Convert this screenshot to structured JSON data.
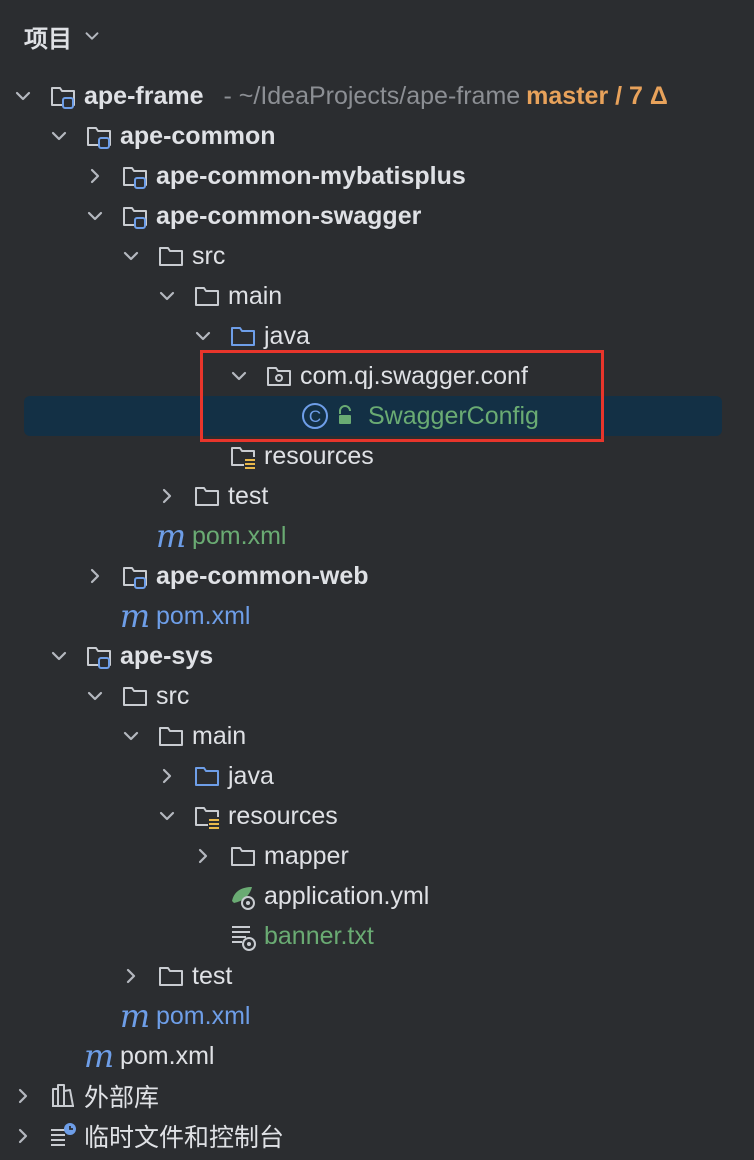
{
  "panel": {
    "title": "项目"
  },
  "tree": {
    "root": {
      "name": "ape-frame",
      "path": "- ~/IdeaProjects/ape-frame",
      "branch": "master / 7 Δ"
    },
    "ape_common": "ape-common",
    "ape_common_mybatisplus": "ape-common-mybatisplus",
    "ape_common_swagger": "ape-common-swagger",
    "swagger_src": "src",
    "swagger_main": "main",
    "swagger_java": "java",
    "swagger_pkg": "com.qj.swagger.conf",
    "swagger_class": "SwaggerConfig",
    "swagger_resources": "resources",
    "swagger_test": "test",
    "swagger_pom": "pom.xml",
    "ape_common_web": "ape-common-web",
    "common_pom": "pom.xml",
    "ape_sys": "ape-sys",
    "sys_src": "src",
    "sys_main": "main",
    "sys_java": "java",
    "sys_resources": "resources",
    "sys_mapper": "mapper",
    "sys_app_yml": "application.yml",
    "sys_banner": "banner.txt",
    "sys_test": "test",
    "sys_pom": "pom.xml",
    "root_pom": "pom.xml",
    "external_libs": "外部库",
    "scratches": "临时文件和控制台"
  },
  "icons": {
    "class_letter": "C",
    "maven_letter": "m"
  },
  "colors": {
    "background": "#2b2d30",
    "selection": "#133045",
    "highlight_box": "#e8352b",
    "branch": "#e8a25b",
    "modified_green": "#6aab73",
    "pom_blue": "#6e9ee8"
  }
}
